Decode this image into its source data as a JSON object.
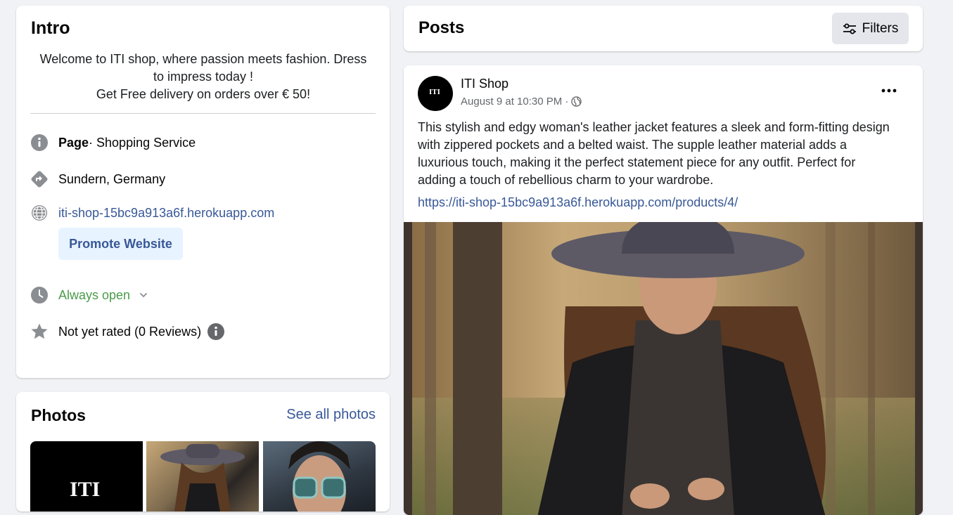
{
  "intro": {
    "title": "Intro",
    "bio_lines": [
      "Welcome to ITI shop, where passion meets fashion. Dress",
      "to impress today !",
      "Get Free delivery on orders over € 50!"
    ],
    "page_label": "Page",
    "category": " · Shopping Service",
    "location": "Sundern, Germany",
    "website": "iti-shop-15bc9a913a6f.herokuapp.com",
    "promote_label": "Promote Website",
    "hours": "Always open",
    "rating": "Not yet rated (0 Reviews)"
  },
  "photos": {
    "title": "Photos",
    "see_all": "See all photos",
    "logo_text": "ITI"
  },
  "posts": {
    "title": "Posts",
    "filters_label": "Filters"
  },
  "post": {
    "author": "ITI Shop",
    "date": "August 9 at 10:30 PM ·",
    "avatar_text": "ITI",
    "text_lines": [
      "This stylish and edgy woman's leather jacket features a sleek and form-fitting design",
      "with zippered pockets and a belted waist. The supple leather material adds a",
      "luxurious touch, making it the perfect statement piece for any outfit. Perfect for",
      "adding a touch of rebellious charm to your wardrobe."
    ],
    "link": "https://iti-shop-15bc9a913a6f.herokuapp.com/products/4/"
  },
  "colors": {
    "link": "#385898",
    "green": "#4a9b4a",
    "icon_gray": "#65676b"
  },
  "icons": [
    "info-icon",
    "directions-icon",
    "globe-icon",
    "clock-icon",
    "star-icon",
    "filters-icon",
    "more-icon"
  ]
}
